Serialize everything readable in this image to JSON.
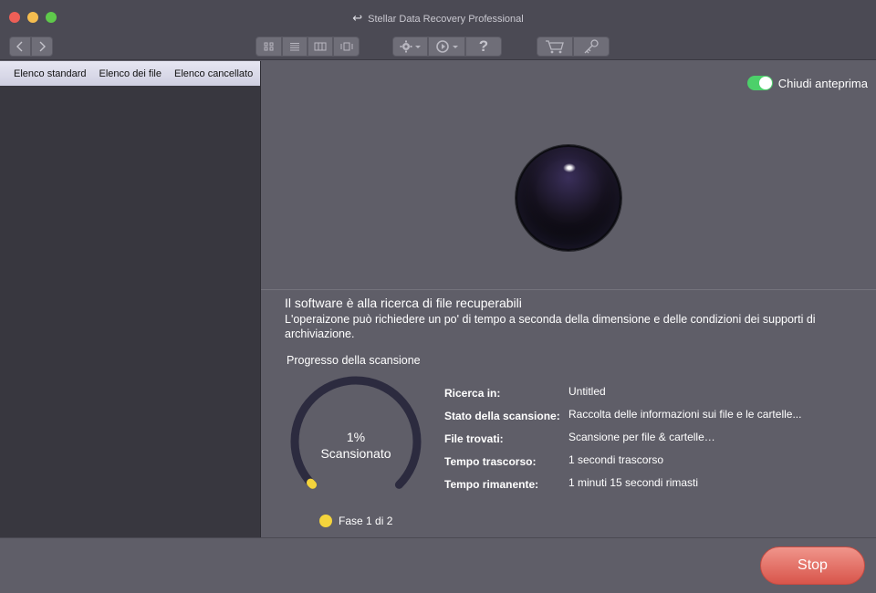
{
  "window": {
    "title": "Stellar Data Recovery Professional"
  },
  "colors": {
    "accent_green": "#4cd06a",
    "stop_red": "#e06a60",
    "phase_yellow": "#f4d43c",
    "gauge_track": "#2c2b3f"
  },
  "toolbar": {
    "icons": [
      "chevron-left-icon",
      "chevron-right-icon",
      "grid-view-icon",
      "list-view-icon",
      "column-view-icon",
      "coverflow-view-icon",
      "gear-icon",
      "history-icon",
      "help-icon",
      "cart-icon",
      "key-icon"
    ],
    "help_label": "?"
  },
  "sidebar": {
    "tabs": [
      {
        "label": "Elenco standard"
      },
      {
        "label": "Elenco dei file"
      },
      {
        "label": "Elenco cancellato"
      }
    ]
  },
  "preview": {
    "toggle_label": "Chiudi anteprima",
    "toggle_on": true
  },
  "scan": {
    "heading": "Il software è alla ricerca di file recuperabili",
    "description": "L'operaizone può richiedere un po' di tempo a seconda della dimensione e delle condizioni dei supporti di archiviazione.",
    "progress_title": "Progresso della scansione",
    "percent_text": "1%",
    "percent_value": 1,
    "percent_label": "Scansionato",
    "phase": "Fase 1 di 2",
    "details": [
      {
        "label": "Ricerca in:",
        "value": "Untitled"
      },
      {
        "label": "Stato della scansione:",
        "value": "Raccolta delle informazioni sui file e le cartelle..."
      },
      {
        "label": "File trovati:",
        "value": "Scansione per file & cartelle…"
      },
      {
        "label": "Tempo trascorso:",
        "value": "1 secondi trascorso"
      },
      {
        "label": "Tempo rimanente:",
        "value": "1 minuti 15 secondi rimasti"
      }
    ]
  },
  "footer": {
    "stop_label": "Stop"
  }
}
